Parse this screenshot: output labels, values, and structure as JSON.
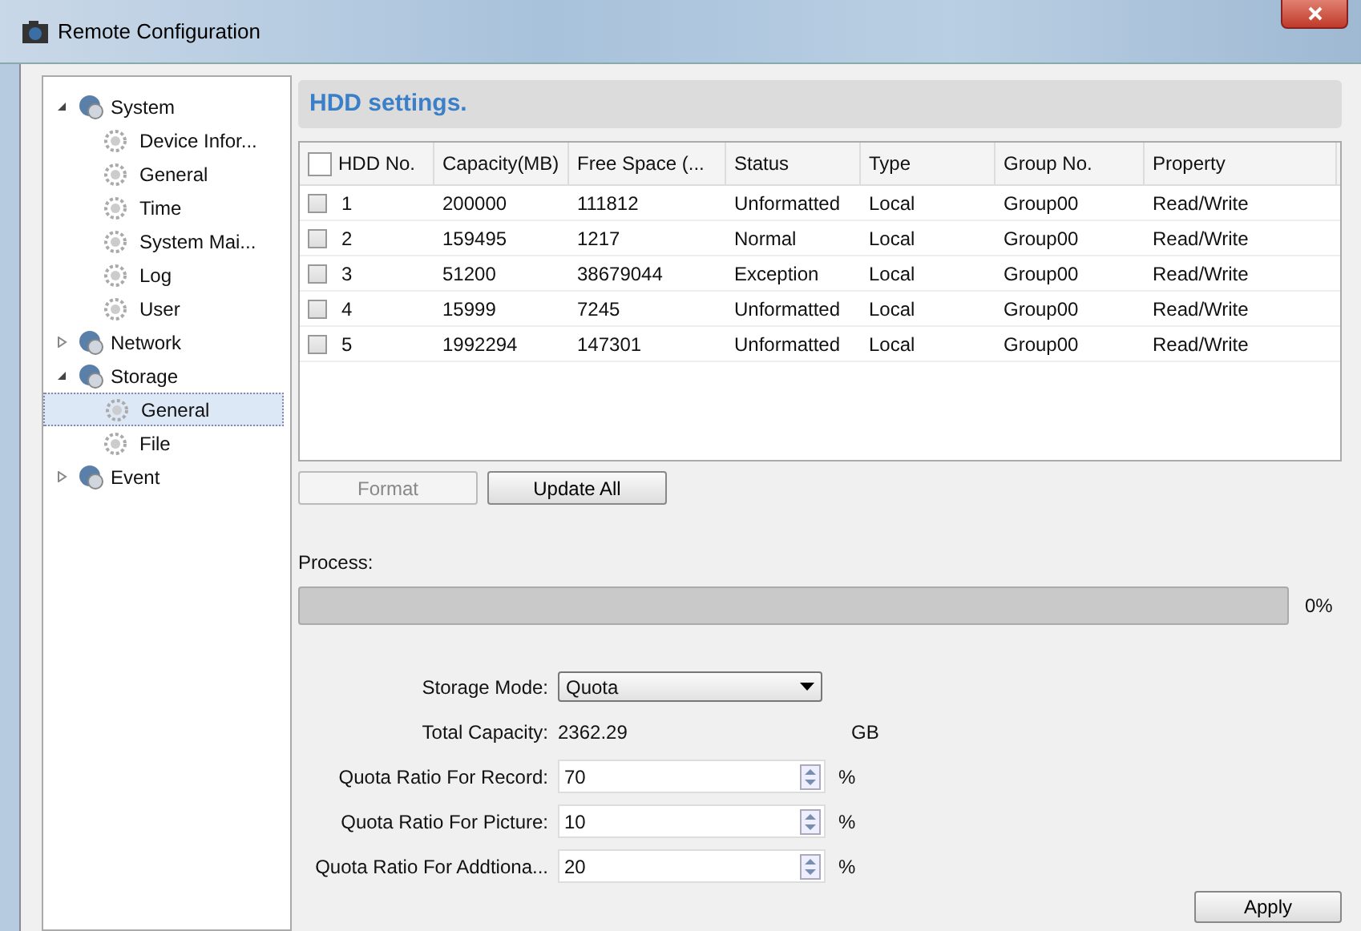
{
  "window": {
    "title": "Remote Configuration"
  },
  "tree": [
    {
      "label": "System",
      "expanded": true,
      "selected": false,
      "children": [
        {
          "label": "Device Infor...",
          "selected": false
        },
        {
          "label": "General",
          "selected": false
        },
        {
          "label": "Time",
          "selected": false
        },
        {
          "label": "System Mai...",
          "selected": false
        },
        {
          "label": "Log",
          "selected": false
        },
        {
          "label": "User",
          "selected": false
        }
      ]
    },
    {
      "label": "Network",
      "expanded": false,
      "selected": false
    },
    {
      "label": "Storage",
      "expanded": true,
      "selected": false,
      "children": [
        {
          "label": "General",
          "selected": true
        },
        {
          "label": "File",
          "selected": false
        }
      ]
    },
    {
      "label": "Event",
      "expanded": false,
      "selected": false
    }
  ],
  "section_title": "HDD settings.",
  "table": {
    "select_all": false,
    "columns": [
      "HDD No.",
      "Capacity(MB)",
      "Free Space (...",
      "Status",
      "Type",
      "Group No.",
      "Property"
    ],
    "rows": [
      {
        "checked": false,
        "cells": [
          "1",
          "200000",
          "111812",
          "Unformatted",
          "Local",
          "Group00",
          "Read/Write"
        ]
      },
      {
        "checked": false,
        "cells": [
          "2",
          "159495",
          "1217",
          "Normal",
          "Local",
          "Group00",
          "Read/Write"
        ]
      },
      {
        "checked": false,
        "cells": [
          "3",
          "51200",
          "38679044",
          "Exception",
          "Local",
          "Group00",
          "Read/Write"
        ]
      },
      {
        "checked": false,
        "cells": [
          "4",
          "15999",
          "7245",
          "Unformatted",
          "Local",
          "Group00",
          "Read/Write"
        ]
      },
      {
        "checked": false,
        "cells": [
          "5",
          "1992294",
          "147301",
          "Unformatted",
          "Local",
          "Group00",
          "Read/Write"
        ]
      }
    ]
  },
  "buttons": [
    {
      "label": "Format",
      "disabled": true
    },
    {
      "label": "Update All",
      "disabled": false
    }
  ],
  "process": {
    "label": "Process:",
    "level": 0,
    "reading": "0%"
  },
  "form": [
    {
      "kind": "select",
      "label": "Storage Mode:",
      "value": "Quota"
    },
    {
      "kind": "text",
      "label": "Total Capacity:",
      "value": "2362.29",
      "unit": "GB"
    },
    {
      "kind": "spinner",
      "label": "Quota Ratio For Record:",
      "value": "70",
      "unit": "%"
    },
    {
      "kind": "spinner",
      "label": "Quota Ratio For Picture:",
      "value": "10",
      "unit": "%"
    },
    {
      "kind": "spinner",
      "label": "Quota Ratio For Addtiona...",
      "value": "20",
      "unit": "%"
    }
  ],
  "apply": "Apply"
}
